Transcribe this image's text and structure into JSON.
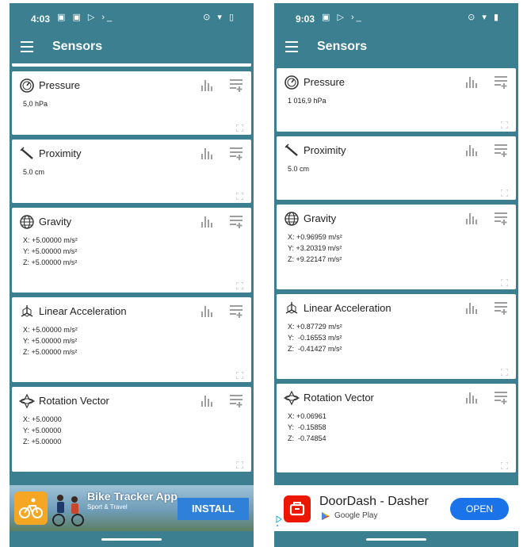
{
  "phones": [
    {
      "status": {
        "time": "4:03",
        "left_icons": "▣ ▣ ▷ ›_",
        "right_icons": "⊙ ▾ ▯"
      },
      "app_bar": {
        "title": "Sensors"
      },
      "cards": [
        {
          "title": "Pressure",
          "icon": "pressure-gauge-icon",
          "values": [
            "5,0 hPa"
          ]
        },
        {
          "title": "Proximity",
          "icon": "proximity-sensor-icon",
          "values": [
            "5.0 cm"
          ]
        },
        {
          "title": "Gravity",
          "icon": "globe-icon",
          "values": [
            "X: +5.00000 m/s²",
            "Y: +5.00000 m/s²",
            "Z: +5.00000 m/s²"
          ]
        },
        {
          "title": "Linear Acceleration",
          "icon": "axes-cube-icon",
          "values": [
            "X: +5.00000 m/s²",
            "Y: +5.00000 m/s²",
            "Z: +5.00000 m/s²"
          ]
        },
        {
          "title": "Rotation Vector",
          "icon": "rotation-icon",
          "values": [
            "X: +5.00000",
            "Y: +5.00000",
            "Z: +5.00000"
          ]
        }
      ],
      "ad": {
        "title": "Bike Tracker App",
        "subtitle": "Sport & Travel",
        "button": "INSTALL"
      }
    },
    {
      "status": {
        "time": "9:03",
        "left_icons": "▣ ▷ ›_",
        "right_icons": "⊙ ▾ ▮"
      },
      "app_bar": {
        "title": "Sensors"
      },
      "cards": [
        {
          "title": "Pressure",
          "icon": "pressure-gauge-icon",
          "values": [
            "1 016,9 hPa"
          ]
        },
        {
          "title": "Proximity",
          "icon": "proximity-sensor-icon",
          "values": [
            "5.0 cm"
          ]
        },
        {
          "title": "Gravity",
          "icon": "globe-icon",
          "values": [
            "X: +0.96959 m/s²",
            "Y: +3.20319 m/s²",
            "Z: +9.22147 m/s²"
          ]
        },
        {
          "title": "Linear Acceleration",
          "icon": "axes-cube-icon",
          "values": [
            "X: +0.87729 m/s²",
            "Y:  -0.16553 m/s²",
            "Z:  -0.41427 m/s²"
          ]
        },
        {
          "title": "Rotation Vector",
          "icon": "rotation-icon",
          "values": [
            "X: +0.06961",
            "Y:  -0.15858",
            "Z:  -0.74854"
          ]
        }
      ],
      "ad": {
        "title": "DoorDash - Dasher",
        "store": "Google Play",
        "button": "OPEN"
      }
    }
  ],
  "colors": {
    "app_primary": "#3b7f91",
    "card": "#ffffff",
    "install_button": "#2f80d8",
    "open_button": "#1a73e8",
    "doordash_red": "#eb1700"
  }
}
